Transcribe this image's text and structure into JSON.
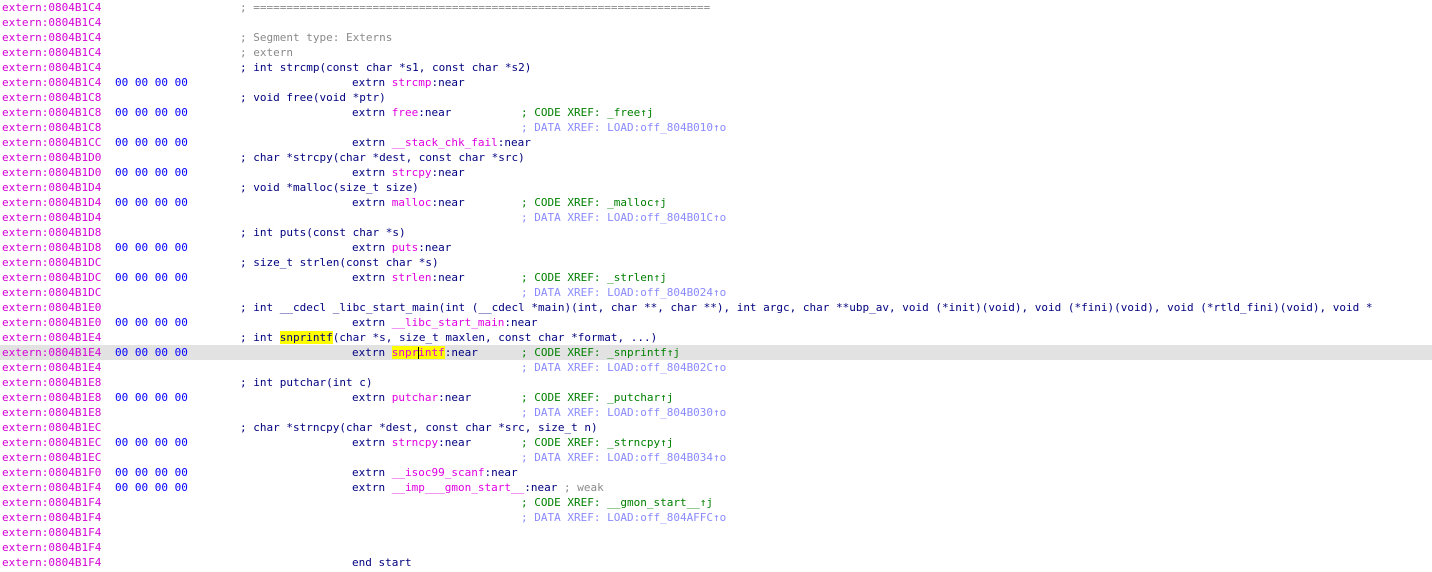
{
  "listing": {
    "addr_prefix": "extern:",
    "sep": ";",
    "equals_bar": "=====================================================================",
    "extrn_kw": "extrn",
    "near_suffix": ":near",
    "lines": [
      {
        "addr": "0804B1C4"
      },
      {
        "addr": "0804B1C4"
      },
      {
        "addr": "0804B1C4"
      },
      {
        "addr": "0804B1C4"
      },
      {
        "addr": "0804B1C4"
      },
      {
        "addr": "0804B1C4",
        "bytes": "00 00 00 00"
      },
      {
        "addr": "0804B1C8"
      },
      {
        "addr": "0804B1C8",
        "bytes": "00 00 00 00"
      },
      {
        "addr": "0804B1C8"
      },
      {
        "addr": "0804B1CC",
        "bytes": "00 00 00 00"
      },
      {
        "addr": "0804B1D0"
      },
      {
        "addr": "0804B1D0",
        "bytes": "00 00 00 00"
      },
      {
        "addr": "0804B1D4"
      },
      {
        "addr": "0804B1D4",
        "bytes": "00 00 00 00"
      },
      {
        "addr": "0804B1D4"
      },
      {
        "addr": "0804B1D8"
      },
      {
        "addr": "0804B1D8",
        "bytes": "00 00 00 00"
      },
      {
        "addr": "0804B1DC"
      },
      {
        "addr": "0804B1DC",
        "bytes": "00 00 00 00"
      },
      {
        "addr": "0804B1DC"
      },
      {
        "addr": "0804B1E0"
      },
      {
        "addr": "0804B1E0",
        "bytes": "00 00 00 00"
      },
      {
        "addr": "0804B1E4"
      },
      {
        "addr": "0804B1E4",
        "bytes": "00 00 00 00"
      },
      {
        "addr": "0804B1E4"
      },
      {
        "addr": "0804B1E8"
      },
      {
        "addr": "0804B1E8",
        "bytes": "00 00 00 00"
      },
      {
        "addr": "0804B1E8"
      },
      {
        "addr": "0804B1EC"
      },
      {
        "addr": "0804B1EC",
        "bytes": "00 00 00 00"
      },
      {
        "addr": "0804B1EC"
      },
      {
        "addr": "0804B1F0",
        "bytes": "00 00 00 00"
      },
      {
        "addr": "0804B1F4",
        "bytes": "00 00 00 00"
      },
      {
        "addr": "0804B1F4"
      },
      {
        "addr": "0804B1F4"
      },
      {
        "addr": "0804B1F4"
      },
      {
        "addr": "0804B1F4"
      },
      {
        "addr": "0804B1F4"
      }
    ],
    "segment_type": "; Segment type: Externs",
    "extern_comment": "; extern",
    "decl_strcmp": "; int strcmp(const char *s1, const char *s2)",
    "decl_free": "; void free(void *ptr)",
    "decl_strcpy": "; char *strcpy(char *dest, const char *src)",
    "decl_malloc": "; void *malloc(size_t size)",
    "decl_puts": "; int puts(const char *s)",
    "decl_strlen": "; size_t strlen(const char *s)",
    "decl_libc_start_main": "; int __cdecl _libc_start_main(int (__cdecl *main)(int, char **, char **), int argc, char **ubp_av, void (*init)(void), void (*fini)(void), void (*rtld_fini)(void), void *",
    "decl_snprintf_pre": "; int ",
    "decl_snprintf_name": "snprintf",
    "decl_snprintf_post": "(char *s, size_t maxlen, const char *format, ...)",
    "decl_putchar": "; int putchar(int c)",
    "decl_strncpy": "; char *strncpy(char *dest, const char *src, size_t n)",
    "sym_strcmp": "strcmp",
    "sym_free": "free",
    "sym_stack_chk_fail": "__stack_chk_fail",
    "sym_strcpy": "strcpy",
    "sym_malloc": "malloc",
    "sym_puts": "puts",
    "sym_strlen": "strlen",
    "sym_libc_start_main": "__libc_start_main",
    "sym_snprintf_a": "snpr",
    "sym_snprintf_b": "intf",
    "sym_putchar": "putchar",
    "sym_strncpy": "strncpy",
    "sym_isoc99_scanf": "__isoc99_scanf",
    "sym_gmon_start": "__imp___gmon_start__",
    "weak_comment": "; weak",
    "xref_free_code": "; CODE XREF: _free↑j",
    "xref_free_data": "; DATA XREF: LOAD:off_804B010↑o",
    "xref_malloc_code": "; CODE XREF: _malloc↑j",
    "xref_malloc_data": "; DATA XREF: LOAD:off_804B01C↑o",
    "xref_strlen_code": "; CODE XREF: _strlen↑j",
    "xref_strlen_data": "; DATA XREF: LOAD:off_804B024↑o",
    "xref_snprintf_code": "; CODE XREF: _snprintf↑j",
    "xref_snprintf_data": "; DATA XREF: LOAD:off_804B02C↑o",
    "xref_putchar_code": "; CODE XREF: _putchar↑j",
    "xref_putchar_data": "; DATA XREF: LOAD:off_804B030↑o",
    "xref_strncpy_code": "; CODE XREF: _strncpy↑j",
    "xref_strncpy_data": "; DATA XREF: LOAD:off_804B034↑o",
    "xref_gmon_code": "; CODE XREF: __gmon_start__↑j",
    "xref_gmon_data": "; DATA XREF: LOAD:off_804AFFC↑o",
    "end_start": "end start"
  },
  "selection": {
    "selected_line_index": 23,
    "highlighted_symbol": "snprintf"
  },
  "colors": {
    "address": "#d400d4",
    "bytes": "#0000ff",
    "symbol": "#e000e0",
    "code_xref": "#008000",
    "data_xref": "#8a8aff",
    "highlight": "#ffff00",
    "selected_row": "#e2e2e2"
  }
}
